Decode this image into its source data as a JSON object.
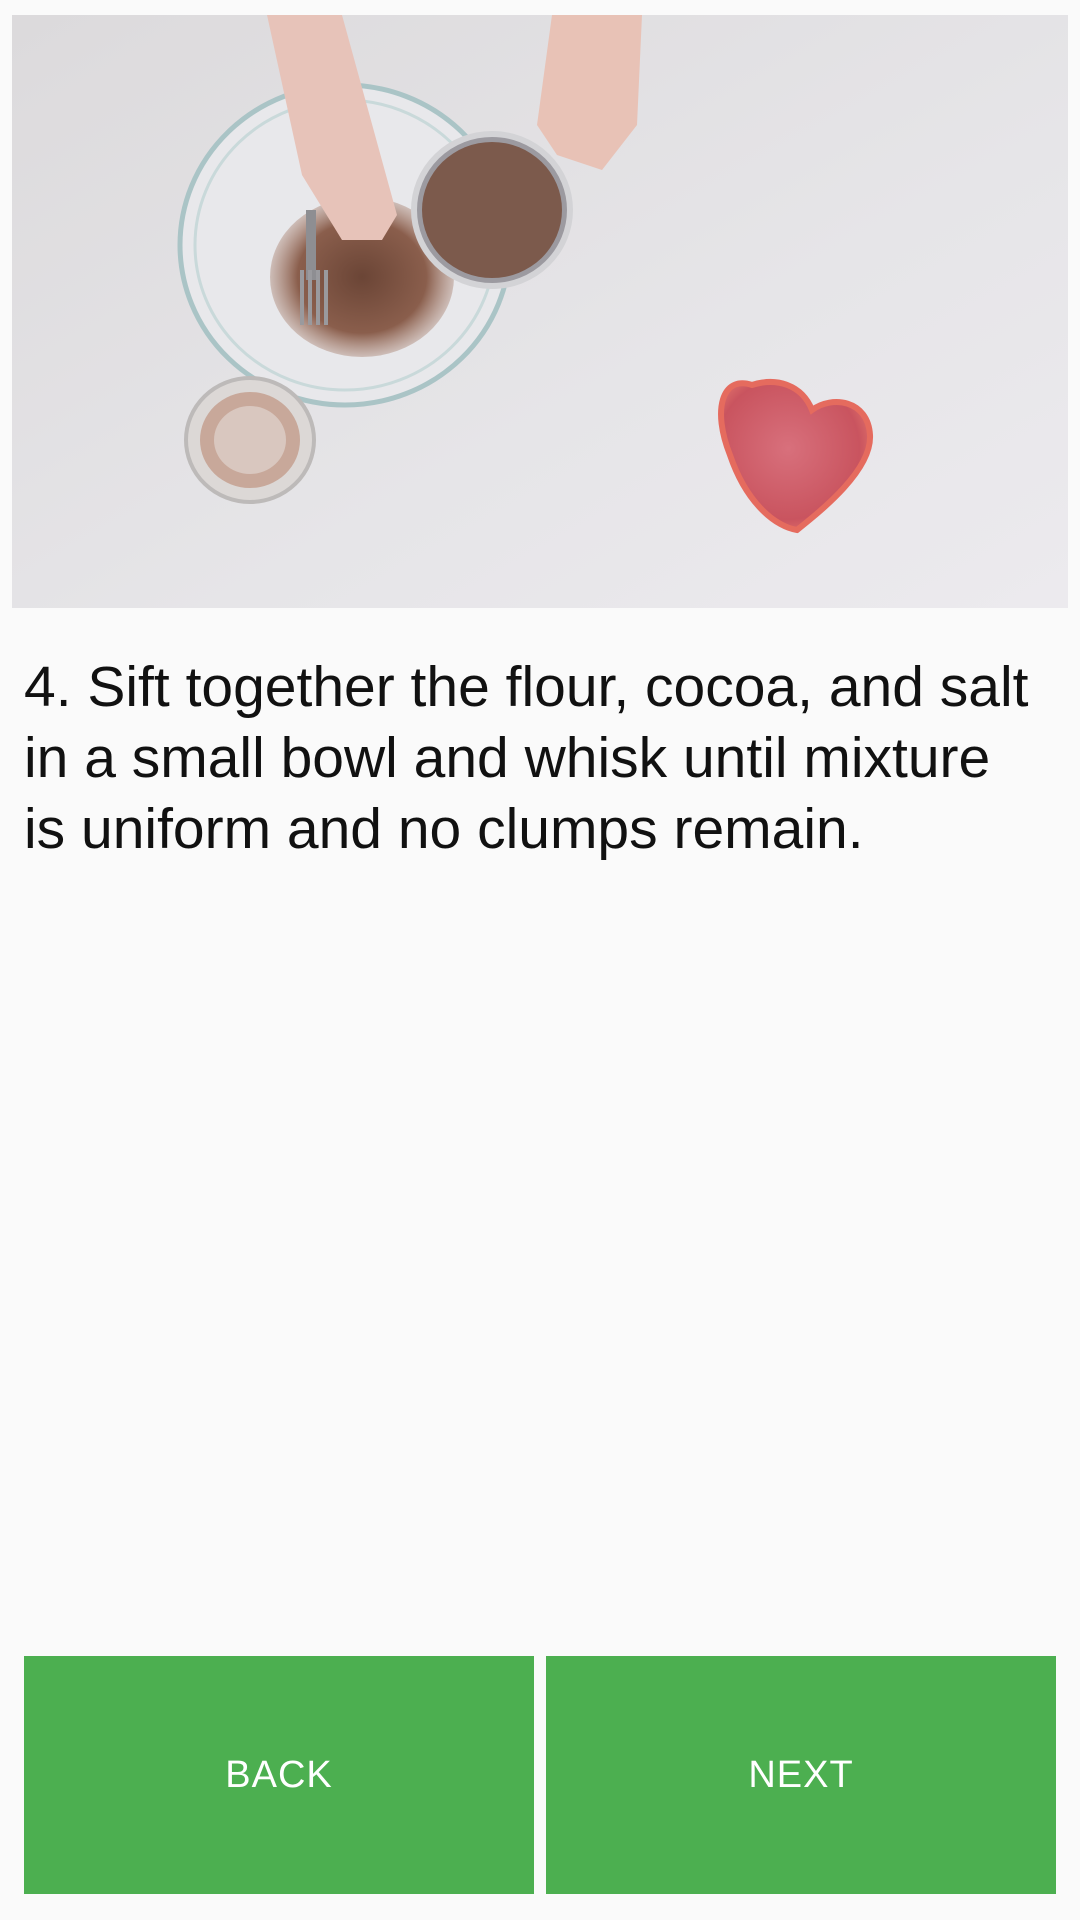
{
  "step": {
    "image_icon": "sifting-cocoa-photo",
    "instruction": "4. Sift together the flour, cocoa, and salt in a small bowl and whisk until mixture is uniform and no clumps remain."
  },
  "navigation": {
    "back_label": "BACK",
    "next_label": "NEXT",
    "button_color": "#4caf50"
  }
}
